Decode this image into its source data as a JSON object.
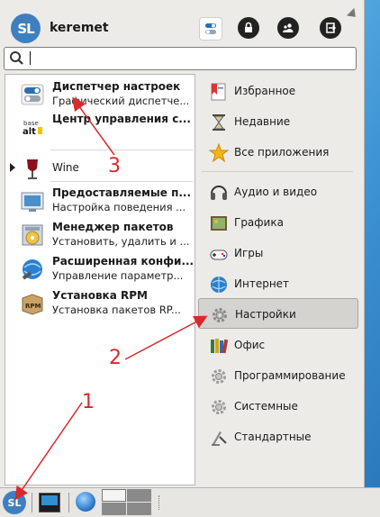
{
  "header": {
    "logo_text": "SL",
    "username": "keremet",
    "buttons": [
      "settings-icon",
      "lock-icon",
      "switch-user-icon",
      "logout-icon"
    ]
  },
  "search": {
    "value": "",
    "placeholder": ""
  },
  "apps": [
    {
      "title": "Диспетчер настроек",
      "desc": "Графический диспетче...",
      "icon": "toggle-settings-icon"
    },
    {
      "title": "Центр управления с...",
      "desc": "",
      "icon": "basealt-icon"
    },
    {
      "title": "Wine",
      "desc": "",
      "icon": "wine-icon"
    },
    {
      "title": "Предоставляемые п...",
      "desc": "Настройка поведения ...",
      "icon": "preferred-apps-icon"
    },
    {
      "title": "Менеджер пакетов",
      "desc": "Установить, удалить и ...",
      "icon": "package-manager-icon"
    },
    {
      "title": "Расширенная конфи...",
      "desc": "Управление параметр...",
      "icon": "advanced-config-icon"
    },
    {
      "title": "Установка RPM",
      "desc": "Установка пакетов RP...",
      "icon": "rpm-icon"
    }
  ],
  "categories": [
    {
      "label": "Избранное",
      "icon": "favorites-icon"
    },
    {
      "label": "Недавние",
      "icon": "recent-icon"
    },
    {
      "label": "Все приложения",
      "icon": "star-icon"
    },
    {
      "label": "Аудио и видео",
      "icon": "multimedia-icon"
    },
    {
      "label": "Графика",
      "icon": "graphics-icon"
    },
    {
      "label": "Игры",
      "icon": "games-icon"
    },
    {
      "label": "Интернет",
      "icon": "internet-icon"
    },
    {
      "label": "Настройки",
      "icon": "settings-gear-icon"
    },
    {
      "label": "Офис",
      "icon": "office-icon"
    },
    {
      "label": "Программирование",
      "icon": "development-icon"
    },
    {
      "label": "Системные",
      "icon": "system-icon"
    },
    {
      "label": "Стандартные",
      "icon": "accessories-icon"
    }
  ],
  "selected_category": "Настройки",
  "taskbar": {
    "logo_text": "SL"
  },
  "annotations": [
    "1",
    "2",
    "3"
  ],
  "colors": {
    "annotation": "#d9292b",
    "accent": "#3f7fc0",
    "selection": "#d4d3cf"
  }
}
